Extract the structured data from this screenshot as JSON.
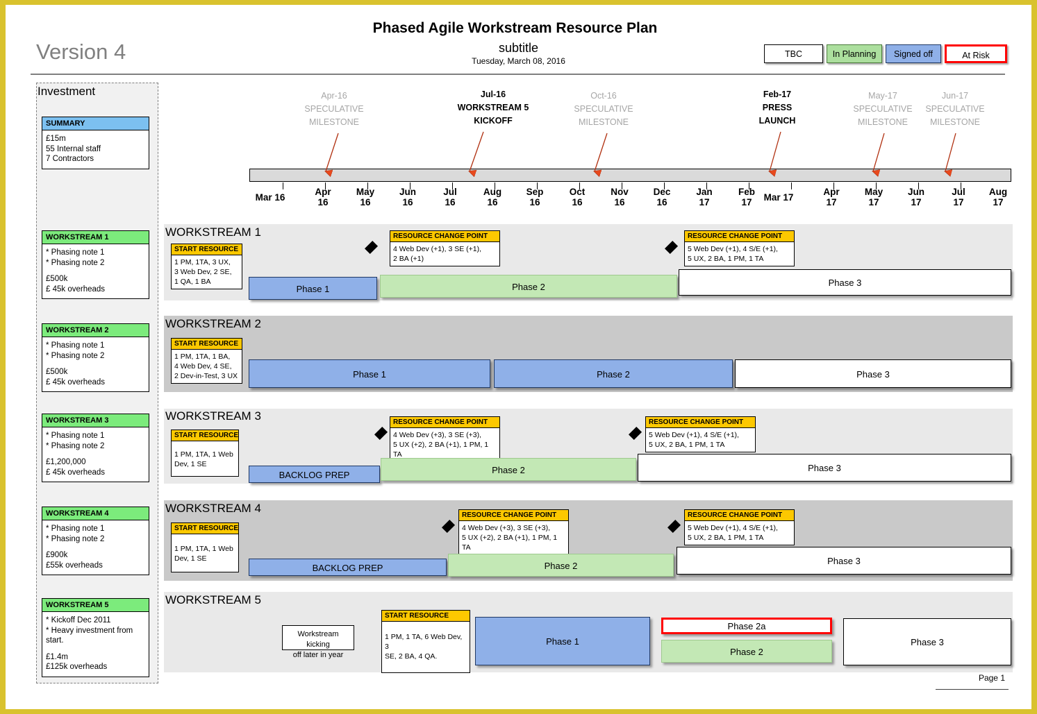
{
  "header": {
    "version": "Version 4",
    "title": "Phased Agile Workstream Resource Plan",
    "subtitle": "subtitle",
    "date": "Tuesday, March 08, 2016",
    "page_number": "Page 1"
  },
  "legend": {
    "items": [
      {
        "label": "TBC",
        "style": "tbc",
        "color": "#ffffff"
      },
      {
        "label": "In Planning",
        "style": "in-planning",
        "color": "#acdf9e"
      },
      {
        "label": "Signed off",
        "style": "signed-off",
        "color": "#8fb0e8"
      },
      {
        "label": "At Risk",
        "style": "at-risk",
        "color": "#ff0000"
      }
    ]
  },
  "investment": {
    "panel_title": "Investment",
    "cards": [
      {
        "heading": "SUMMARY",
        "heading_color": "#7cc0f0",
        "lines": [
          "£15m",
          "55 Internal staff",
          "7 Contractors"
        ]
      },
      {
        "heading": "WORKSTREAM 1",
        "heading_color": "#7ceb7c",
        "notes": [
          "* Phasing note 1",
          "* Phasing note 2"
        ],
        "cost": [
          "£500k",
          "£ 45k overheads"
        ]
      },
      {
        "heading": "WORKSTREAM 2",
        "heading_color": "#7ceb7c",
        "notes": [
          "* Phasing note 1",
          "* Phasing note 2"
        ],
        "cost": [
          "£500k",
          "£ 45k overheads"
        ]
      },
      {
        "heading": "WORKSTREAM 3",
        "heading_color": "#7ceb7c",
        "notes": [
          "* Phasing note 1",
          "* Phasing note 2"
        ],
        "cost": [
          "£1,200,000",
          "£ 45k overheads"
        ]
      },
      {
        "heading": "WORKSTREAM 4",
        "heading_color": "#7ceb7c",
        "notes": [
          "* Phasing note 1",
          "* Phasing note 2"
        ],
        "cost": [
          "£900k",
          "£55k overheads"
        ]
      },
      {
        "heading": "WORKSTREAM 5",
        "heading_color": "#7ceb7c",
        "notes": [
          "* Kickoff Dec 2011",
          "* Heavy investment from start."
        ],
        "cost": [
          "£1.4m",
          "£125k overheads"
        ]
      }
    ]
  },
  "timeline": {
    "axis_labels": [
      "Mar 16",
      "Apr 16",
      "May 16",
      "Jun 16",
      "Jul 16",
      "Aug 16",
      "Sep 16",
      "Oct 16",
      "Nov 16",
      "Dec 16",
      "Jan 17",
      "Feb 17",
      "Mar 17",
      "Apr 17",
      "May 17",
      "Jun 17",
      "Jul 17",
      "Aug 17"
    ],
    "milestones": [
      {
        "date": "Apr-16",
        "line1": "SPECULATIVE",
        "line2": "MILESTONE",
        "kind": "speculative"
      },
      {
        "date": "Jul-16",
        "line1": "WORKSTREAM 5",
        "line2": "KICKOFF",
        "kind": "key"
      },
      {
        "date": "Oct-16",
        "line1": "SPECULATIVE",
        "line2": "MILESTONE",
        "kind": "speculative"
      },
      {
        "date": "Feb-17",
        "line1": "PRESS",
        "line2": "LAUNCH",
        "kind": "key"
      },
      {
        "date": "May-17",
        "line1": "SPECULATIVE",
        "line2": "MILESTONE",
        "kind": "speculative"
      },
      {
        "date": "Jun-17",
        "line1": "SPECULATIVE",
        "line2": "MILESTONE",
        "kind": "speculative"
      }
    ]
  },
  "workstreams": [
    {
      "heading": "WORKSTREAM 1",
      "start_resource": {
        "title": "START RESOURCE",
        "lines": [
          "1 PM, 1TA, 3 UX,",
          "3 Web Dev, 2 SE,",
          "1 QA, 1 BA"
        ]
      },
      "change_points": [
        {
          "title": "RESOURCE CHANGE POINT",
          "lines": [
            "4 Web Dev (+1), 3 SE (+1),",
            "2 BA (+1)"
          ]
        },
        {
          "title": "RESOURCE CHANGE POINT",
          "lines": [
            "5 Web Dev (+1), 4 S/E (+1),",
            "5 UX, 2 BA, 1 PM, 1 TA"
          ]
        }
      ],
      "bars": [
        {
          "label": "Phase 1",
          "status": "signed-off"
        },
        {
          "label": "Phase 2",
          "status": "in-planning"
        },
        {
          "label": "Phase 3",
          "status": "tbc"
        }
      ]
    },
    {
      "heading": "WORKSTREAM 2",
      "start_resource": {
        "title": "START RESOURCE",
        "lines": [
          "1 PM, 1TA, 1 BA,",
          "4 Web Dev, 4 SE,",
          "2 Dev-in-Test, 3 UX"
        ]
      },
      "change_points": [],
      "bars": [
        {
          "label": "Phase 1",
          "status": "signed-off"
        },
        {
          "label": "Phase 2",
          "status": "signed-off"
        },
        {
          "label": "Phase 3",
          "status": "tbc"
        }
      ]
    },
    {
      "heading": "WORKSTREAM 3",
      "start_resource": {
        "title": "START RESOURCE",
        "lines": [
          "1 PM, 1TA, 1 Web",
          "Dev, 1 SE"
        ]
      },
      "change_points": [
        {
          "title": "RESOURCE CHANGE POINT",
          "lines": [
            "4 Web Dev (+3), 3 SE (+3),",
            "5 UX (+2), 2 BA (+1), 1 PM, 1 TA"
          ]
        },
        {
          "title": "RESOURCE CHANGE POINT",
          "lines": [
            "5 Web Dev (+1), 4 S/E (+1),",
            "5 UX, 2 BA, 1 PM, 1 TA"
          ]
        }
      ],
      "bars": [
        {
          "label": "BACKLOG PREP",
          "status": "signed-off"
        },
        {
          "label": "Phase 2",
          "status": "in-planning"
        },
        {
          "label": "Phase 3",
          "status": "tbc"
        }
      ]
    },
    {
      "heading": "WORKSTREAM 4",
      "start_resource": {
        "title": "START RESOURCE",
        "lines": [
          "1 PM, 1TA, 1 Web",
          "Dev, 1 SE"
        ]
      },
      "change_points": [
        {
          "title": "RESOURCE CHANGE POINT",
          "lines": [
            "4 Web Dev (+3), 3 SE (+3),",
            "5 UX (+2), 2 BA (+1), 1 PM, 1 TA"
          ]
        },
        {
          "title": "RESOURCE CHANGE POINT",
          "lines": [
            "5 Web Dev (+1), 4 S/E (+1),",
            "5 UX, 2 BA, 1 PM, 1 TA"
          ]
        }
      ],
      "bars": [
        {
          "label": "BACKLOG PREP",
          "status": "signed-off"
        },
        {
          "label": "Phase 2",
          "status": "in-planning"
        },
        {
          "label": "Phase 3",
          "status": "tbc"
        }
      ]
    },
    {
      "heading": "WORKSTREAM 5",
      "callout": {
        "line1": "Workstream kicking",
        "line2": "off later in year"
      },
      "start_resource": {
        "title": "START RESOURCE",
        "lines": [
          "1 PM, 1 TA, 6 Web Dev, 3",
          "SE, 2 BA, 4 QA."
        ]
      },
      "change_points": [],
      "bars": [
        {
          "label": "Phase 1",
          "status": "signed-off"
        },
        {
          "label": "Phase 2a",
          "status": "at-risk"
        },
        {
          "label": "Phase 2",
          "status": "in-planning"
        },
        {
          "label": "Phase 3",
          "status": "tbc"
        }
      ]
    }
  ]
}
